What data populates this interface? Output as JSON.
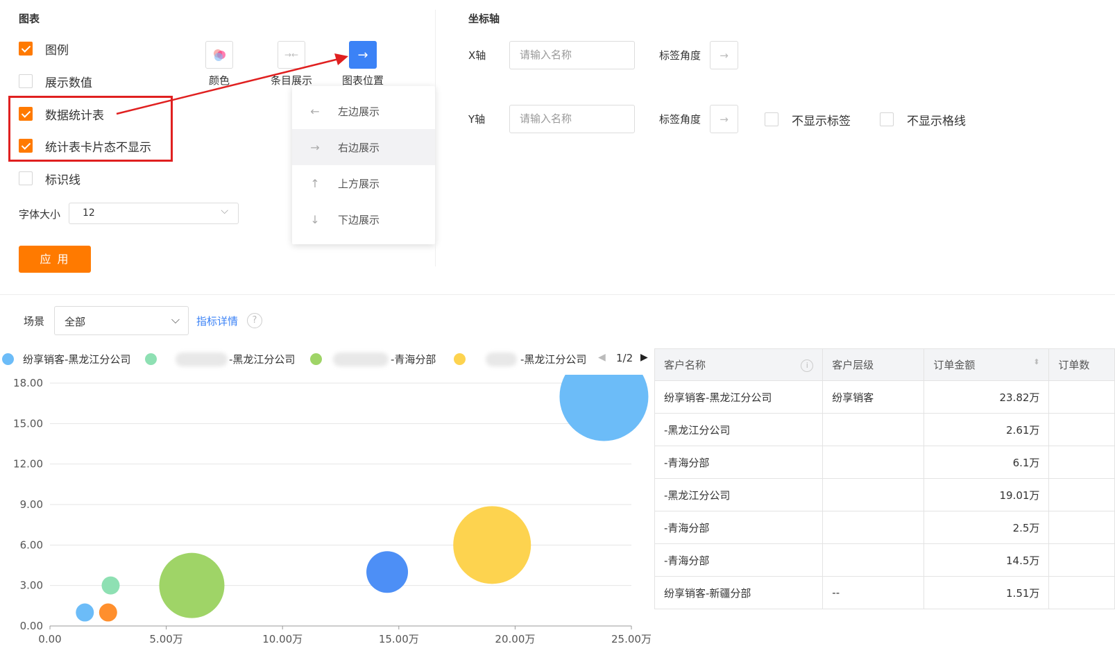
{
  "settings": {
    "chart_section_title": "图表",
    "axis_section_title": "坐标轴",
    "checkboxes": [
      {
        "label": "图例",
        "checked": true
      },
      {
        "label": "展示数值",
        "checked": false
      },
      {
        "label": "数据统计表",
        "checked": true
      },
      {
        "label": "统计表卡片态不显示",
        "checked": true
      },
      {
        "label": "标识线",
        "checked": false
      }
    ],
    "icon_buttons": [
      {
        "label": "颜色",
        "icon": "color-palette-icon"
      },
      {
        "label": "条目展示",
        "icon": "collapse-arrows-icon"
      },
      {
        "label": "图表位置",
        "icon": "arrow-right-icon",
        "active": true
      }
    ],
    "position_menu": [
      {
        "label": "左边展示",
        "icon": "←"
      },
      {
        "label": "右边展示",
        "icon": "→"
      },
      {
        "label": "上方展示",
        "icon": "↑"
      },
      {
        "label": "下边展示",
        "icon": "↓"
      }
    ],
    "font_size_label": "字体大小",
    "font_size_value": "12",
    "apply_label": "应 用",
    "x_axis": {
      "label": "X轴",
      "placeholder": "请输入名称",
      "angle_label": "标签角度"
    },
    "y_axis": {
      "label": "Y轴",
      "placeholder": "请输入名称",
      "angle_label": "标签角度",
      "hide_labels": "不显示标签",
      "hide_grid": "不显示格线"
    }
  },
  "filter": {
    "scene_label": "场景",
    "scene_value": "全部",
    "detail_link": "指标详情"
  },
  "legend": {
    "items": [
      {
        "name": "纷享销客-黑龙江分公司",
        "color": "#6cbcf8"
      },
      {
        "name": "-黑龙江分公司",
        "color": "#8ee0b3"
      },
      {
        "name": "-青海分部",
        "color": "#9fd467"
      },
      {
        "name": "-黑龙江分公司",
        "color": "#fdd34f"
      }
    ],
    "page": "1/2"
  },
  "chart_data": {
    "type": "scatter",
    "xlabel": "",
    "ylabel": "",
    "x_ticks": [
      "0.00",
      "5.00万",
      "10.00万",
      "15.00万",
      "20.00万",
      "25.00万"
    ],
    "y_ticks": [
      "0.00",
      "3.00",
      "6.00",
      "9.00",
      "12.00",
      "15.00",
      "18.00"
    ],
    "xlim": [
      0,
      25
    ],
    "ylim": [
      0,
      18
    ],
    "points": [
      {
        "x": 23.82,
        "y": 17.0,
        "r": 64,
        "color": "#6cbcf8"
      },
      {
        "x": 2.61,
        "y": 3.0,
        "r": 13,
        "color": "#8ee0b3"
      },
      {
        "x": 6.1,
        "y": 3.0,
        "r": 47,
        "color": "#9fd467"
      },
      {
        "x": 19.01,
        "y": 6.0,
        "r": 56,
        "color": "#fdd34f"
      },
      {
        "x": 1.5,
        "y": 1.0,
        "r": 13,
        "color": "#6cbcf8"
      },
      {
        "x": 2.5,
        "y": 1.0,
        "r": 13,
        "color": "#ff8f2d"
      },
      {
        "x": 14.5,
        "y": 4.0,
        "r": 30,
        "color": "#4d8ff6"
      }
    ]
  },
  "table": {
    "headers": [
      "客户名称",
      "客户层级",
      "订单金额",
      "订单数"
    ],
    "rows": [
      [
        "纷享销客-黑龙江分公司",
        "纷享销客",
        "23.82万"
      ],
      [
        "-黑龙江分公司",
        "",
        "2.61万"
      ],
      [
        "-青海分部",
        "",
        "6.1万"
      ],
      [
        "-黑龙江分公司",
        "",
        "19.01万"
      ],
      [
        "-青海分部",
        "",
        "2.5万"
      ],
      [
        "-青海分部",
        "",
        "14.5万"
      ],
      [
        "纷享销客-新疆分部",
        "--",
        "1.51万"
      ]
    ]
  }
}
